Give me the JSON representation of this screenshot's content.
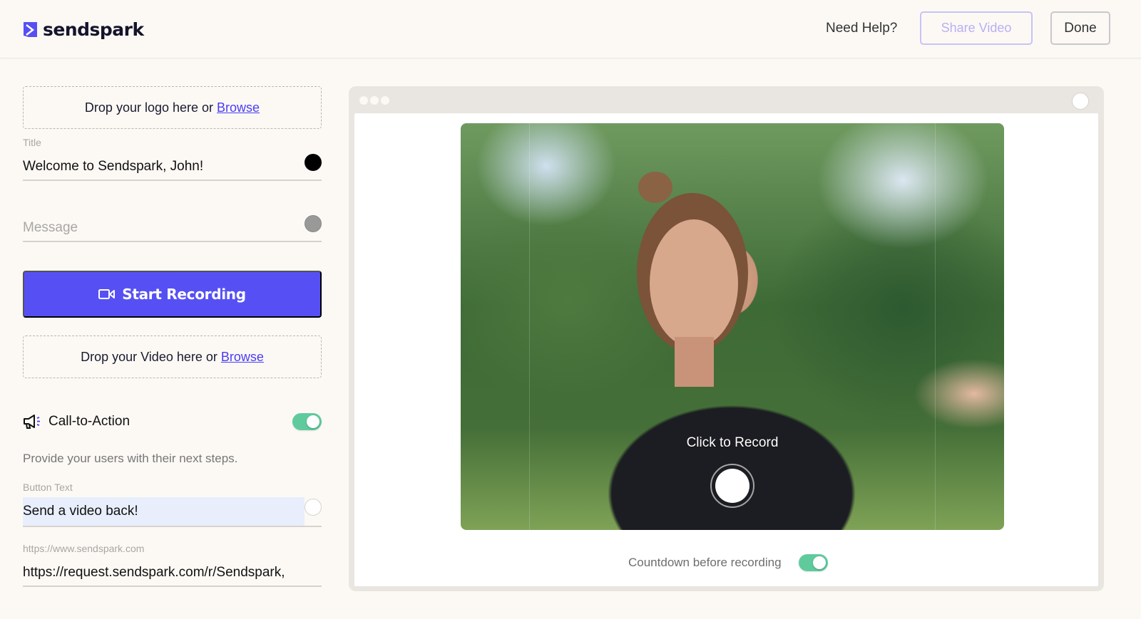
{
  "header": {
    "brand": "sendspark",
    "need_help": "Need Help?",
    "share_video": "Share Video",
    "done": "Done",
    "brand_color": "#5650f4"
  },
  "left_panel": {
    "logo_drop": {
      "text": "Drop your logo here or",
      "link": "Browse"
    },
    "title_field": {
      "label": "Title",
      "value": "Welcome to Sendspark, John!",
      "color": "#000000"
    },
    "message_field": {
      "placeholder": "Message",
      "color": "#999999"
    },
    "start_recording": "Start Recording",
    "video_drop": {
      "text": "Drop your Video here or",
      "link": "Browse"
    },
    "cta": {
      "label": "Call-to-Action",
      "enabled": true,
      "description": "Provide your users with their next steps.",
      "button_text_label": "Button Text",
      "button_text_value": "Send a video back!",
      "button_color": "#ffffff",
      "url_placeholder": "https://www.sendspark.com",
      "url_value": "https://request.sendspark.com/r/Sendspark,"
    }
  },
  "preview": {
    "click_to_record": "Click to Record",
    "countdown_label": "Countdown before recording",
    "countdown_enabled": true,
    "toggle_color": "#5fcb9d"
  }
}
